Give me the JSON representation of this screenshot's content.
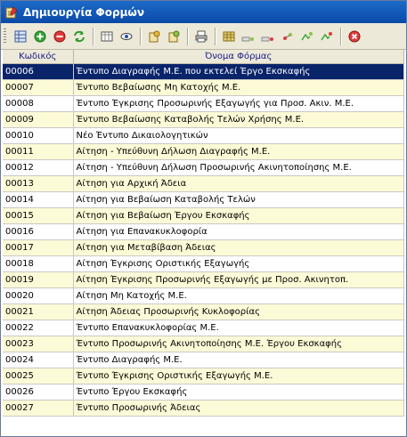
{
  "window": {
    "title": "Δημιουργία Φορμών"
  },
  "colors": {
    "titlebar": "#0a4aa8",
    "row_alt": "#fdfbd7",
    "selected": "#0a246a"
  },
  "toolbar": {
    "buttons": [
      "grid-icon",
      "add-icon",
      "remove-icon",
      "refresh-icon",
      "table-view-icon",
      "preview-icon",
      "export-icon",
      "import-icon",
      "print-icon",
      "form-grid-icon",
      "form-edit-icon",
      "form-delete-icon",
      "form-add-icon",
      "form-copy-icon",
      "form-move-icon",
      "close-icon"
    ]
  },
  "table": {
    "columns": [
      "Κωδικός",
      "Όνομα Φόρμας"
    ],
    "rows": [
      [
        "00006",
        "Έντυπο Διαγραφής Μ.Ε. που εκτελεί Έργο Εκσκαφής"
      ],
      [
        "00007",
        "Έντυπο Βεβαίωσης Μη Κατοχής Μ.Ε."
      ],
      [
        "00008",
        "Έντυπο Έγκρισης Προσωρινής Εξαγωγής για Προσ. Ακιν. Μ.Ε."
      ],
      [
        "00009",
        "Έντυπο Βεβαίωσης Καταβολής Τελών Χρήσης Μ.Ε."
      ],
      [
        "00010",
        "Νέο Έντυπο Δικαιολογητικών"
      ],
      [
        "00011",
        "Αίτηση - Υπεύθυνη Δήλωση Διαγραφής Μ.Ε."
      ],
      [
        "00012",
        "Αίτηση - Υπεύθυνη Δήλωση Προσωρινής Ακινητοποίησης Μ.Ε."
      ],
      [
        "00013",
        "Αίτηση για Αρχική Άδεια"
      ],
      [
        "00014",
        "Αίτηση για Βεβαίωση Καταβολής Τελών"
      ],
      [
        "00015",
        "Αίτηση για Βεβαίωση Έργου Εκσκαφής"
      ],
      [
        "00016",
        "Αίτηση για Επανακυκλοφορία"
      ],
      [
        "00017",
        "Αίτηση για Μεταβίβαση Άδειας"
      ],
      [
        "00018",
        "Αίτηση Έγκρισης Οριστικής Εξαγωγής"
      ],
      [
        "00019",
        "Αίτηση Έγκρισης Προσωρινής Εξαγωγής με Προσ. Ακινητοπ."
      ],
      [
        "00020",
        "Αίτηση Μη Κατοχής Μ.Ε."
      ],
      [
        "00021",
        "Αίτηση Άδειας Προσωρινής Κυκλοφορίας"
      ],
      [
        "00022",
        "Έντυπο Επανακυκλοφορίας Μ.Ε."
      ],
      [
        "00023",
        "Έντυπο Προσωρινής Ακινητοποίησης Μ.Ε. Έργου Εκσκαφής"
      ],
      [
        "00024",
        "Έντυπο Διαγραφής Μ.Ε."
      ],
      [
        "00025",
        "Έντυπο Έγκρισης Οριστικής Εξαγωγής Μ.Ε."
      ],
      [
        "00026",
        "Έντυπο Έργου Εκσκαφής"
      ],
      [
        "00027",
        "Έντυπο Προσωρινής Άδειας"
      ]
    ],
    "selected_index": 0
  }
}
